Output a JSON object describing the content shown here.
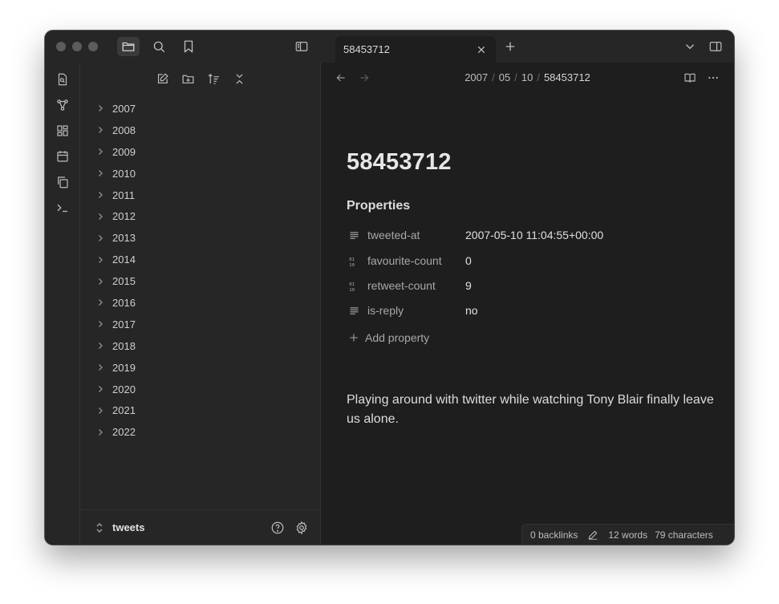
{
  "tab": {
    "title": "58453712"
  },
  "sidebar": {
    "folders": [
      {
        "label": "2007"
      },
      {
        "label": "2008"
      },
      {
        "label": "2009"
      },
      {
        "label": "2010"
      },
      {
        "label": "2011"
      },
      {
        "label": "2012"
      },
      {
        "label": "2013"
      },
      {
        "label": "2014"
      },
      {
        "label": "2015"
      },
      {
        "label": "2016"
      },
      {
        "label": "2017"
      },
      {
        "label": "2018"
      },
      {
        "label": "2019"
      },
      {
        "label": "2020"
      },
      {
        "label": "2021"
      },
      {
        "label": "2022"
      }
    ],
    "vault_name": "tweets"
  },
  "breadcrumb": [
    "2007",
    "05",
    "10",
    "58453712"
  ],
  "note": {
    "title": "58453712",
    "properties_heading": "Properties",
    "properties": [
      {
        "key": "tweeted-at",
        "value": "2007-05-10 11:04:55+00:00",
        "icon": "text-icon"
      },
      {
        "key": "favourite-count",
        "value": "0",
        "icon": "number-icon"
      },
      {
        "key": "retweet-count",
        "value": "9",
        "icon": "number-icon"
      },
      {
        "key": "is-reply",
        "value": "no",
        "icon": "text-icon"
      }
    ],
    "add_property_label": "Add property",
    "body": "Playing around with twitter while watching Tony Blair finally leave us alone."
  },
  "status": {
    "backlinks": "0 backlinks",
    "words": "12 words",
    "characters": "79 characters"
  },
  "colors": {
    "background": "#1e1e1e",
    "panel": "#262626",
    "border": "#333333",
    "text": "#dadada",
    "muted": "#a8a8a8"
  }
}
